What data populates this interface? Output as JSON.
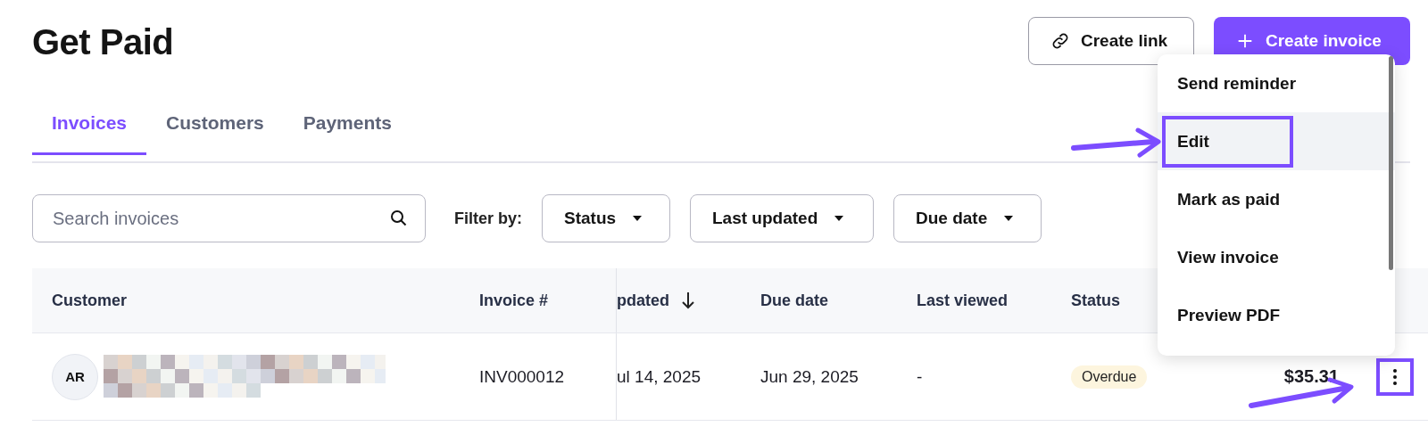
{
  "page": {
    "title": "Get Paid"
  },
  "actions": [
    {
      "kind": "outline",
      "label": "Create link"
    },
    {
      "kind": "primary",
      "label": "Create invoice"
    }
  ],
  "tabs": [
    {
      "label": "Invoices",
      "selected": true
    },
    {
      "label": "Customers",
      "selected": false
    },
    {
      "label": "Payments",
      "selected": false
    }
  ],
  "search": {
    "placeholder": "Search invoices"
  },
  "filter_label": "Filter by:",
  "filters": [
    "Status",
    "Last updated",
    "Due date"
  ],
  "table": {
    "columns": [
      {
        "label": "Customer",
        "sorted": false
      },
      {
        "label": "Invoice #",
        "sorted": false
      },
      {
        "label": "pdated",
        "sorted": true
      },
      {
        "label": "Due date",
        "sorted": false
      },
      {
        "label": "Last viewed",
        "sorted": false
      },
      {
        "label": "Status",
        "sorted": false
      }
    ],
    "rows": [
      {
        "initials": "AR",
        "invoice": "INV000012",
        "updated": "ul 14, 2025",
        "due": "Jun 29, 2025",
        "last_viewed": "-",
        "status": "Overdue",
        "amount": "$35.31",
        "menu_open": true
      }
    ]
  },
  "menu": {
    "items": [
      {
        "label": "Send reminder",
        "selected": false
      },
      {
        "label": "Edit",
        "selected": true
      },
      {
        "label": "Mark as paid",
        "selected": false
      },
      {
        "label": "View invoice",
        "selected": false
      },
      {
        "label": "Preview PDF",
        "selected": false
      }
    ]
  }
}
